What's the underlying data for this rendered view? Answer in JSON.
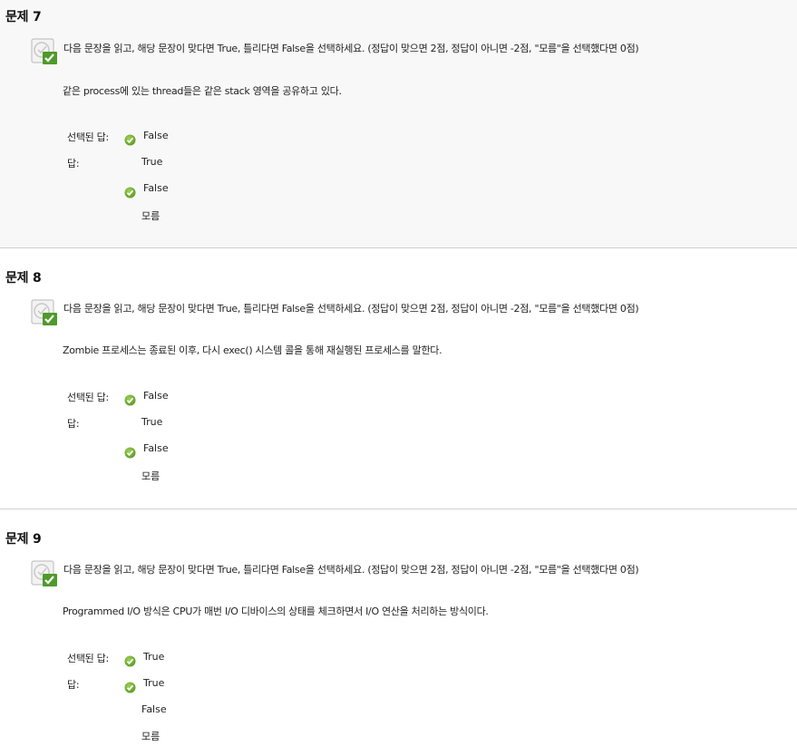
{
  "questions": [
    {
      "title": "문제 7",
      "instruction": "다음 문장을 읽고, 해당 문장이 맞다면 True, 틀리다면 False을 선택하세요. (정답이 맞으면 2점, 정답이 아니면 -2점, \"모름\"을 선택했다면 0점)",
      "statement": "같은 process에 있는 thread들은 같은 stack 영역을 공유하고 있다.",
      "selected_label": "선택된 답:",
      "answer_label": "답:",
      "selected_answer": "False",
      "options": [
        {
          "label": "True",
          "correct": false
        },
        {
          "label": "False",
          "correct": true
        },
        {
          "label": "모름",
          "correct": false
        }
      ]
    },
    {
      "title": "문제 8",
      "instruction": "다음 문장을 읽고, 해당 문장이 맞다면 True, 틀리다면 False을 선택하세요. (정답이 맞으면 2점, 정답이 아니면 -2점, \"모름\"을 선택했다면 0점)",
      "statement": "Zombie 프로세스는 종료된 이후, 다시 exec() 시스템 콜을 통해 재실행된 프로세스를 말한다.",
      "selected_label": "선택된 답:",
      "answer_label": "답:",
      "selected_answer": "False",
      "options": [
        {
          "label": "True",
          "correct": false
        },
        {
          "label": "False",
          "correct": true
        },
        {
          "label": "모름",
          "correct": false
        }
      ]
    },
    {
      "title": "문제 9",
      "instruction": "다음 문장을 읽고, 해당 문장이 맞다면 True, 틀리다면 False을 선택하세요. (정답이 맞으면 2점, 정답이 아니면 -2점, \"모름\"을 선택했다면 0점)",
      "statement": "Programmed I/O 방식은 CPU가 매번 I/O 디바이스의 상태를 체크하면서 I/O 연산을 처리하는 방식이다.",
      "selected_label": "선택된 답:",
      "answer_label": "답:",
      "selected_answer": "True",
      "options": [
        {
          "label": "True",
          "correct": true
        },
        {
          "label": "False",
          "correct": false
        },
        {
          "label": "모름",
          "correct": false
        }
      ]
    }
  ],
  "colors": {
    "check_green": "#6aa32a",
    "shaded_background": "#f8f8f8",
    "divider": "#cfcfcf"
  }
}
